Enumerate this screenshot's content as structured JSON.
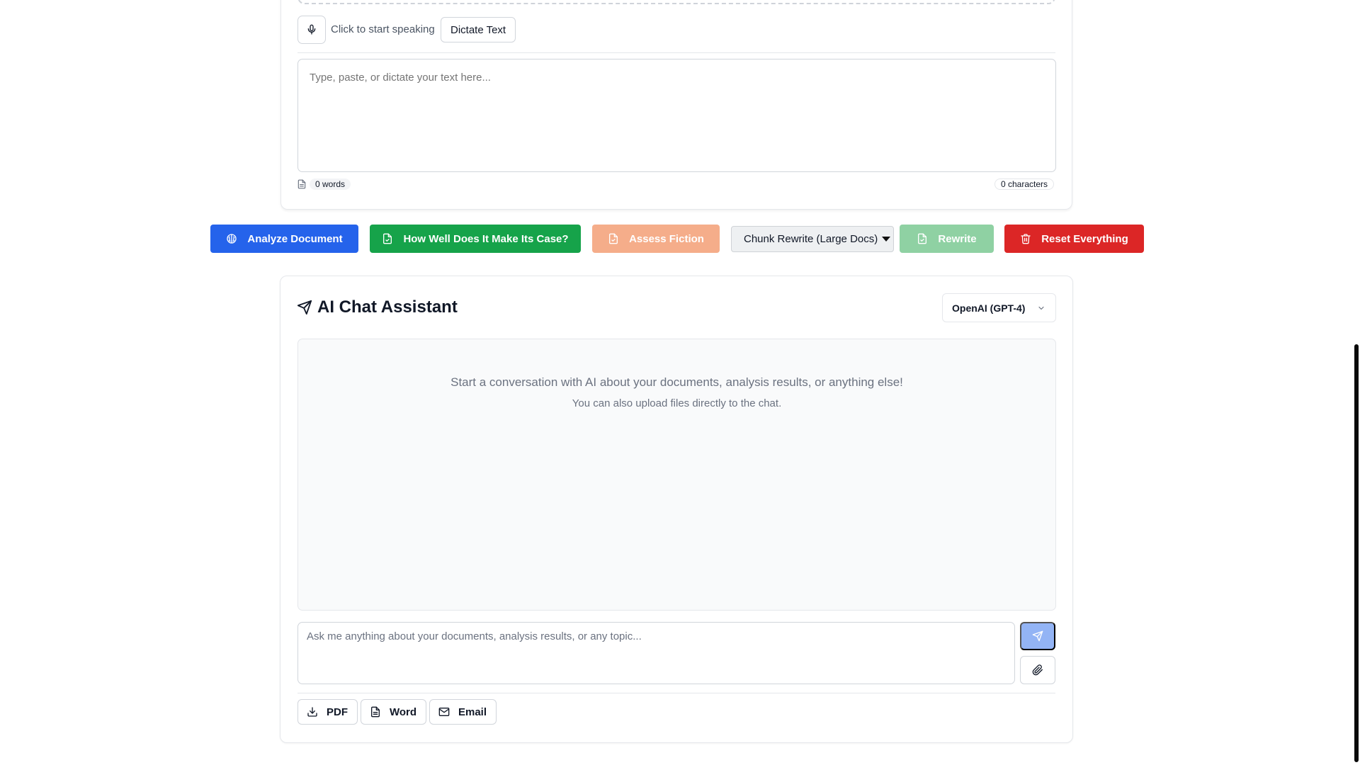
{
  "dictation": {
    "hint": "Click to start speaking",
    "button_label": "Dictate Text"
  },
  "editor": {
    "placeholder": "Type, paste, or dictate your text here...",
    "word_count": "0 words",
    "char_count": "0 characters"
  },
  "actions": {
    "analyze": "Analyze Document",
    "case": "How Well Does It Make Its Case?",
    "fiction": "Assess Fiction",
    "chunk_select": "Chunk Rewrite (Large Docs)",
    "rewrite": "Rewrite",
    "reset": "Reset Everything"
  },
  "chat": {
    "title": "AI Chat Assistant",
    "model": "OpenAI (GPT-4)",
    "empty_main": "Start a conversation with AI about your documents, analysis results, or anything else!",
    "empty_sub": "You can also upload files directly to the chat.",
    "input_placeholder": "Ask me anything about your documents, analysis results, or any topic..."
  },
  "export": {
    "pdf": "PDF",
    "word": "Word",
    "email": "Email"
  },
  "colors": {
    "primary_blue": "#2563eb",
    "green": "#16a34a",
    "fiction_orange_disabled": "#f5ad8a",
    "rewrite_green_disabled": "#8fd1a3",
    "red": "#dc2626",
    "send_disabled": "#93b4f5"
  },
  "icons": {
    "mic": "microphone-icon",
    "doc": "document-icon",
    "brain": "brain-icon",
    "file_check": "file-check-icon",
    "trash": "trash-icon",
    "send": "send-icon",
    "paperclip": "paperclip-icon",
    "download": "download-icon",
    "mail": "mail-icon",
    "chevron": "chevron-down-icon"
  }
}
